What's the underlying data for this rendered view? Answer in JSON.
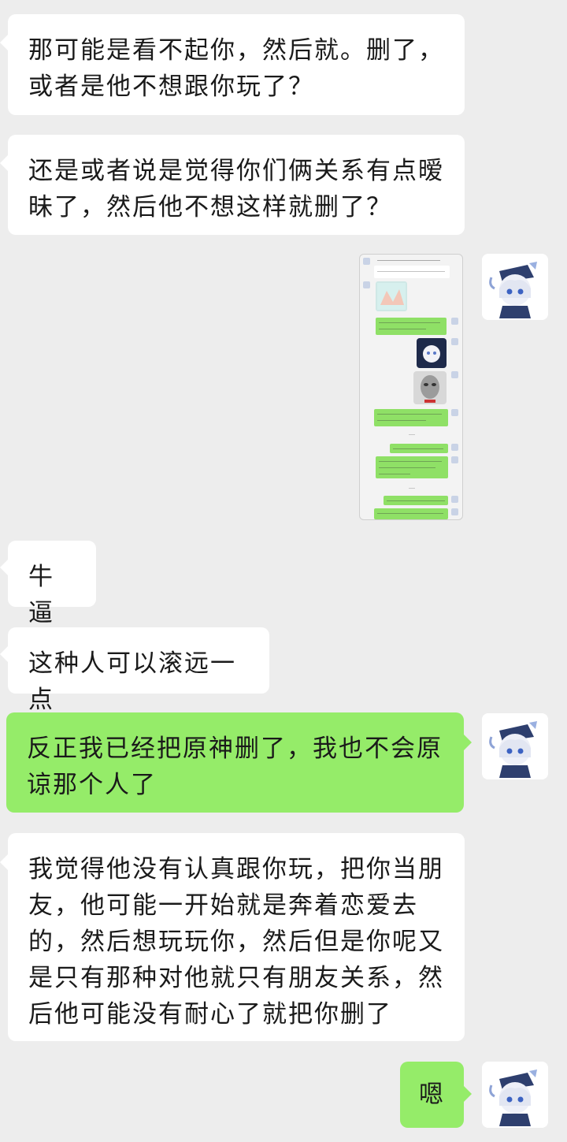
{
  "messages": [
    {
      "text": "那可能是看不起你，然后就。删了，或者是他不想跟你玩了？"
    },
    {
      "text": "还是或者说是觉得你们俩关系有点暧昧了，然后他不想这样就删了？"
    },
    {
      "text": "牛逼"
    },
    {
      "text": "这种人可以滚远一点"
    },
    {
      "text": "反正我已经把原神删了，我也不会原谅那个人了"
    },
    {
      "text": "我觉得他没有认真跟你玩，把你当朋友，他可能一开始就是奔着恋爱去的，然后想玩玩你，然后但是你呢又是只有那种对他就只有朋友关系，然后他可能没有耐心了就把你删了"
    },
    {
      "text": "嗯"
    }
  ],
  "colors": {
    "background": "#ededed",
    "incoming_bubble": "#ffffff",
    "outgoing_bubble": "#95ec69"
  },
  "icons": {
    "avatar": "anime-character-avatar",
    "sticker_1": "anime-character-sticker",
    "sticker_2": "meme-face-sticker"
  }
}
